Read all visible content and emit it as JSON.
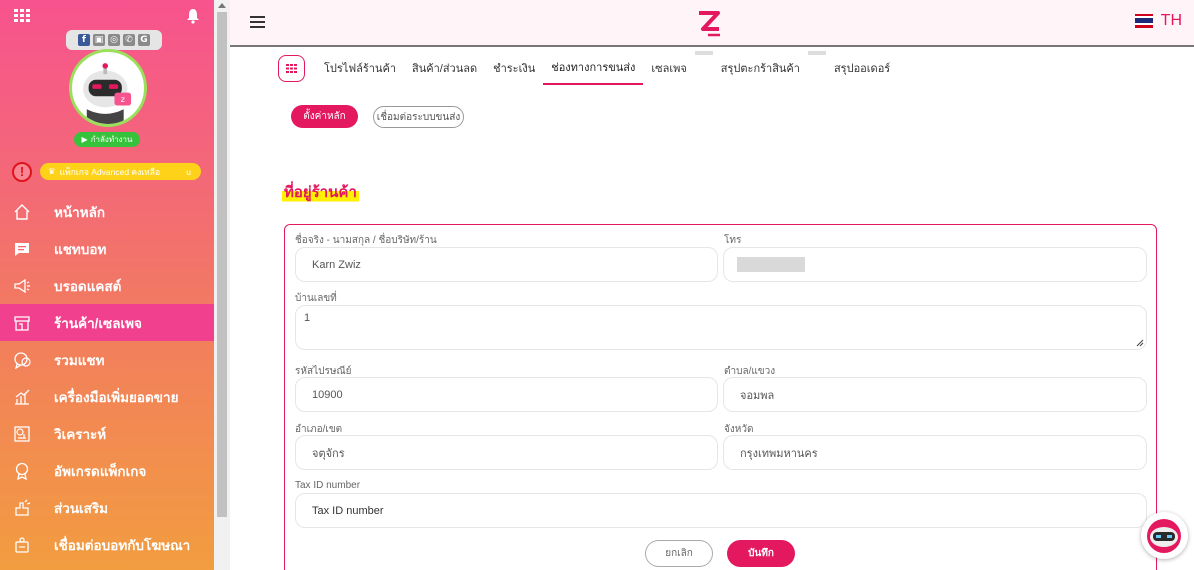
{
  "sidebar": {
    "status": "กำลังทำงาน",
    "package": "แพ็กเกจ Advanced คงเหลือ",
    "package_suffix": "u",
    "social": [
      "f",
      "▣",
      "◎",
      "✆",
      "G"
    ],
    "items": [
      {
        "label": "หน้าหลัก",
        "icon": "home-icon"
      },
      {
        "label": "แชทบอท",
        "icon": "chat-icon"
      },
      {
        "label": "บรอดแคสต์",
        "icon": "megaphone-icon"
      },
      {
        "label": "ร้านค้า/เซลเพจ",
        "icon": "store-icon"
      },
      {
        "label": "รวมแชท",
        "icon": "chats-icon"
      },
      {
        "label": "เครื่องมือเพิ่มยอดขาย",
        "icon": "growth-chart-icon"
      },
      {
        "label": "วิเคราะห์",
        "icon": "analytics-icon"
      },
      {
        "label": "อัพเกรดแพ็กเกจ",
        "icon": "badge-icon"
      },
      {
        "label": "ส่วนเสริม",
        "icon": "addon-icon"
      },
      {
        "label": "เชื่อมต่อบอทกับโฆษณา",
        "icon": "ads-icon"
      }
    ]
  },
  "topbar": {
    "lang": "TH"
  },
  "tabs": [
    "โปรไฟล์ร้านค้า",
    "สินค้า/ส่วนลด",
    "ชำระเงิน",
    "ช่องทางการขนส่ง",
    "เซลเพจ",
    "สรุปตะกร้าสินค้า",
    "สรุปออเดอร์"
  ],
  "subtabs": {
    "main": "ตั้งค่าหลัก",
    "connect": "เชื่อมต่อระบบขนส่ง"
  },
  "section_title": "ที่อยู่ร้านค้า",
  "form": {
    "name_label": "ชื่อจริง - นามสกุล / ชื่อบริษัท/ร้าน",
    "name_value": "Karn Zwiz",
    "phone_label": "โทร",
    "address_label": "บ้านเลขที่",
    "address_value": "1",
    "postcode_label": "รหัสไปรษณีย์",
    "postcode_value": "10900",
    "subdistrict_label": "ตำบล/แขวง",
    "subdistrict_value": "จอมพล",
    "district_label": "อำเภอ/เขต",
    "district_value": "จตุจักร",
    "province_label": "จังหวัด",
    "province_value": "กรุงเทพมหานคร",
    "taxid_label": "Tax ID number",
    "taxid_placeholder": "Tax ID number",
    "cancel": "ยกเลิก",
    "save": "บันทึก"
  }
}
